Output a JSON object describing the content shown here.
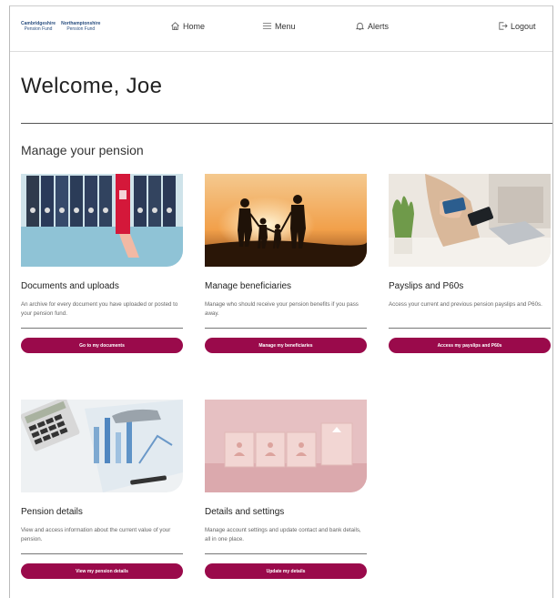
{
  "header": {
    "logo_left_line1": "Cambridgeshire",
    "logo_left_line2": "Pension Fund",
    "logo_right_line1": "Northamptonshire",
    "logo_right_line2": "Pension Fund",
    "home_label": "Home",
    "menu_label": "Menu",
    "alerts_label": "Alerts",
    "logout_label": "Logout"
  },
  "welcome": {
    "text": "Welcome,  Joe"
  },
  "section": {
    "title": "Manage your pension"
  },
  "cards": [
    {
      "title": "Documents and uploads",
      "description": "An archive for every document you have uploaded or posted to your pension fund.",
      "button": "Go to my documents"
    },
    {
      "title": "Manage beneficiaries",
      "description": "Manage who should receive your pension benefits if you pass away.",
      "button": "Manage my beneficiaries"
    },
    {
      "title": "Payslips and P60s",
      "description": "Access your current and previous pension payslips and P60s.",
      "button": "Access my payslips and P60s"
    },
    {
      "title": "Pension details",
      "description": "View and access information about the current value of your pension.",
      "button": "View my pension details"
    },
    {
      "title": "Details and settings",
      "description": "Manage account settings and update contact and bank details, all in one place.",
      "button": "Update my details"
    }
  ],
  "colors": {
    "accent": "#9a0a4b",
    "logo_blue": "#2a4f80"
  }
}
